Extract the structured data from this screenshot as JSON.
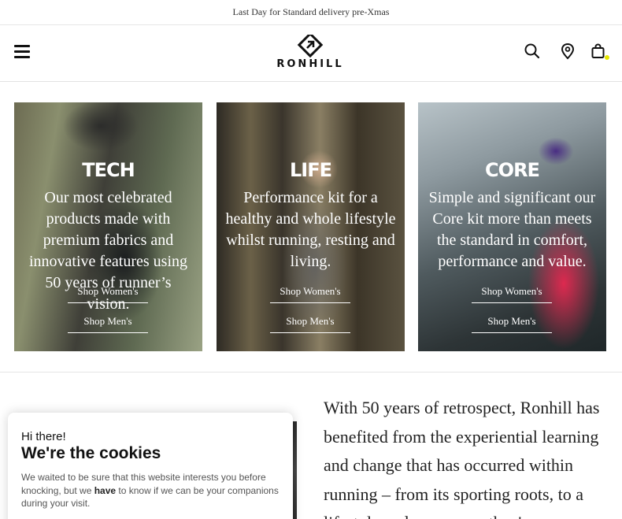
{
  "announcement": "Last Day for Standard delivery pre-Xmas",
  "header": {
    "logo_text": "RONHILL",
    "icons": [
      "menu-icon",
      "search-icon",
      "location-pin-icon",
      "shopping-bag-icon"
    ],
    "cart_dot_color": "#e6e600"
  },
  "cards": [
    {
      "title": "TECH",
      "description": "Our most celebrated products made with premium fabrics and innovative features using 50 years of runner’s vision.",
      "women_link": "Shop Women's",
      "men_link": "Shop Men's"
    },
    {
      "title": "LIFE",
      "description": "Performance kit for a healthy and whole lifestyle whilst running, resting and living.",
      "women_link": "Shop Women's",
      "men_link": "Shop Men's"
    },
    {
      "title": "CORE",
      "description": "Simple and significant our Core kit more than meets the standard in comfort, performance and value.",
      "women_link": "Shop Women's",
      "men_link": "Shop Men's"
    }
  ],
  "story": "With 50 years of retrospect, Ronhill has benefited from the experiential learning and change that has occurred within running – from its sporting roots, to a lifestyle and an escape, they're",
  "cookie": {
    "greeting": "Hi there!",
    "title": "We're the cookies",
    "text_before": "We waited to be sure that this website interests you before knocking, but we ",
    "text_bold": "have",
    "text_after": " to know if we can be your companions during your visit."
  }
}
